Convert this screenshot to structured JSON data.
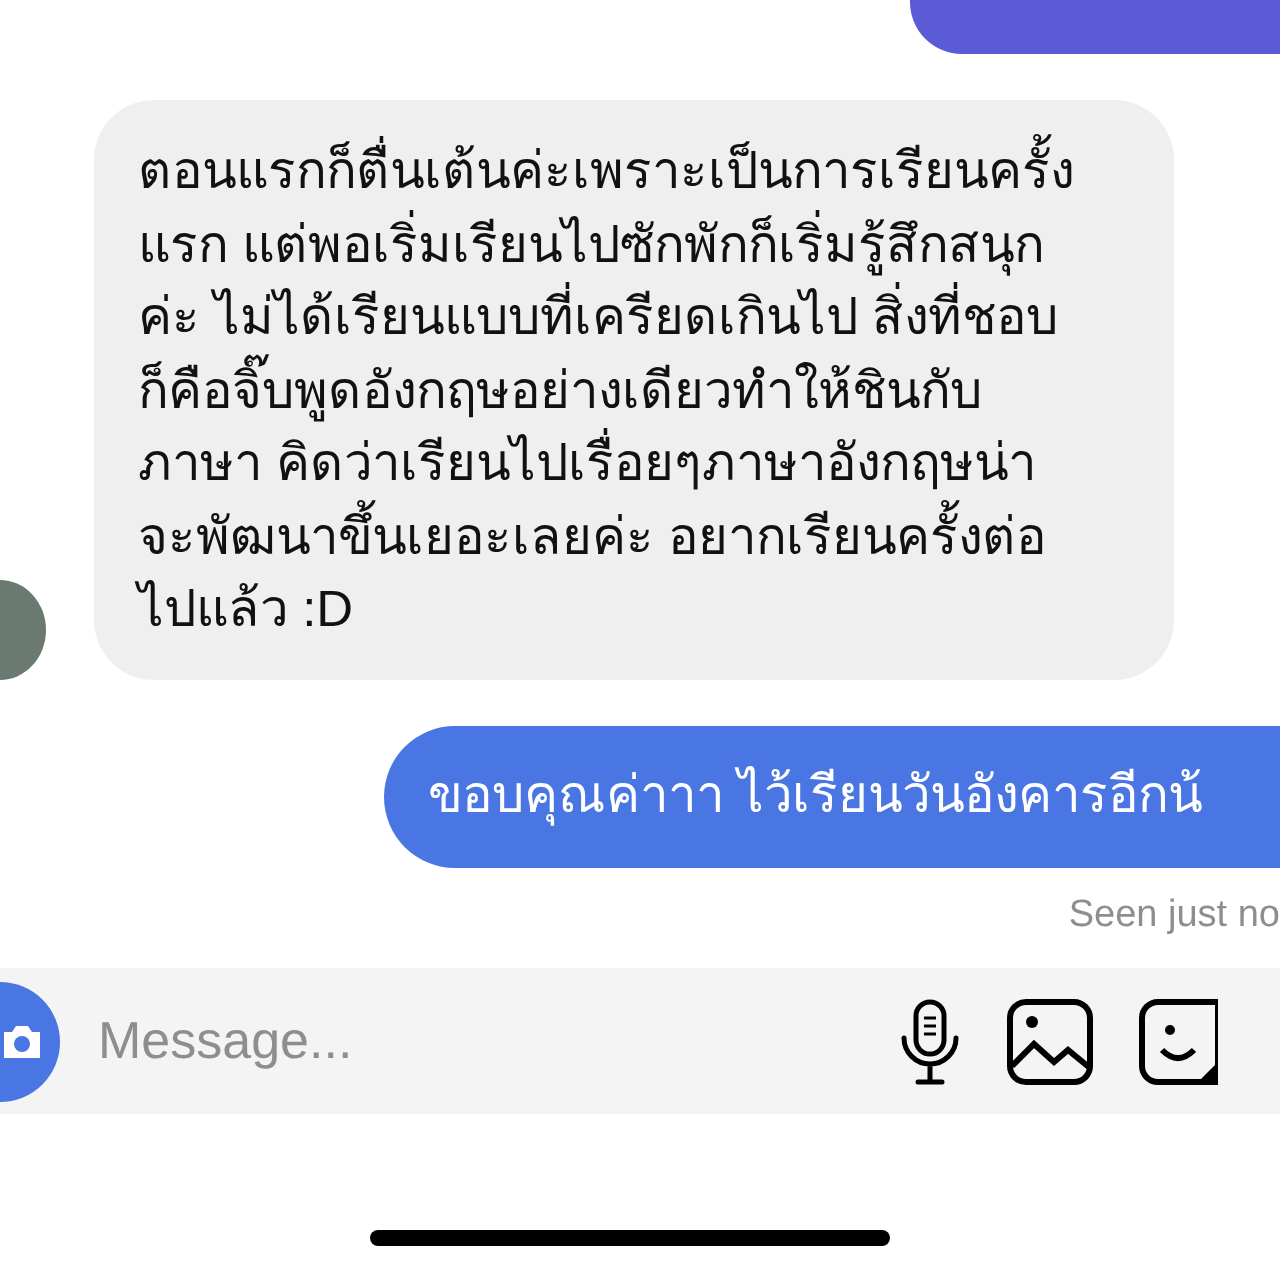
{
  "messages": [
    {
      "kind": "outgoing"
    },
    {
      "kind": "incoming",
      "text": "ตอนแรกก็ตื่นเต้นค่ะเพราะเป็นการเรียนครั้ง\nแรก แต่พอเริ่มเรียนไปซักพักก็เริ่มรู้สึกสนุก\nค่ะ ไม่ได้เรียนแบบที่เครียดเกินไป สิ่งที่ชอบ\nก็คือจิ๊บพูดอังกฤษอย่างเดียวทำให้ชินกับ\nภาษา คิดว่าเรียนไปเรื่อยๆภาษาอังกฤษน่า\nจะพัฒนาขึ้นเยอะเลยค่ะ อยากเรียนครั้งต่อ\nไปแล้ว :D"
    },
    {
      "kind": "outgoing",
      "text": "ขอบคุณค่าาา ไว้เรียนวันอังคารอีกน้"
    }
  ],
  "seen": "Seen just no",
  "composer": {
    "placeholder": "Message..."
  }
}
